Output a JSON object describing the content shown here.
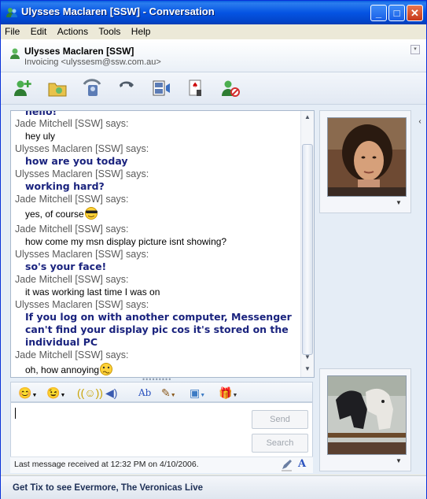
{
  "window": {
    "title": "Ulysses Maclaren [SSW] - Conversation",
    "minimize_label": "_",
    "maximize_label": "□",
    "close_label": "✕"
  },
  "menu": [
    "File",
    "Edit",
    "Actions",
    "Tools",
    "Help"
  ],
  "contact": {
    "name": "Ulysses Maclaren [SSW]",
    "status": "Invoicing <ulyssesm@ssw.com.au>"
  },
  "toolbar": {
    "icons": [
      "invite-contact-icon",
      "send-files-icon",
      "start-video-call-icon",
      "call-phone-icon",
      "video-clip-icon",
      "games-icon",
      "block-contact-icon"
    ]
  },
  "conversation": {
    "top_partial": "hello!",
    "messages": [
      {
        "sender": "Jade Mitchell [SSW] says:",
        "text": "hey uly",
        "mine": false
      },
      {
        "sender": "Ulysses Maclaren [SSW] says:",
        "text": "how are you today",
        "mine": true
      },
      {
        "sender": "Ulysses Maclaren [SSW] says:",
        "text": "working hard?",
        "mine": true
      },
      {
        "sender": "Jade Mitchell [SSW] says:",
        "text": "yes, of course",
        "mine": false,
        "emoticon": "cool-emoticon"
      },
      {
        "sender": "Jade Mitchell [SSW] says:",
        "text": "how come my msn display picture isnt showing?",
        "mine": false
      },
      {
        "sender": "Ulysses Maclaren [SSW] says:",
        "text": "so's your face!",
        "mine": true
      },
      {
        "sender": "Jade Mitchell [SSW] says:",
        "text": "it was working last time I was on",
        "mine": false
      },
      {
        "sender": "Ulysses Maclaren [SSW] says:",
        "text": "If you log on with another computer, Messenger can't find your display pic cos it's stored on the individual PC",
        "mine": true
      },
      {
        "sender": "Jade Mitchell [SSW] says:",
        "text": "oh, how annoying",
        "mine": false,
        "emoticon": "confused-emoticon"
      }
    ]
  },
  "format_toolbar": {
    "icons": [
      "emoticon-icon",
      "wink-icon",
      "nudge-icon",
      "voice-clip-icon",
      "font-icon",
      "background-icon",
      "send-file-icon",
      "gift-icon"
    ]
  },
  "compose": {
    "value": "",
    "send_label": "Send",
    "search_label": "Search"
  },
  "status_bar": {
    "last_message": "Last message received at 12:32 PM on 4/10/2006."
  },
  "banner": {
    "text": "Get Tix to see Evermore, The Veronicas Live"
  },
  "colors": {
    "title_bar": "#0554e3",
    "my_text": "#1a237e",
    "sender_label": "#5a5a5a"
  }
}
